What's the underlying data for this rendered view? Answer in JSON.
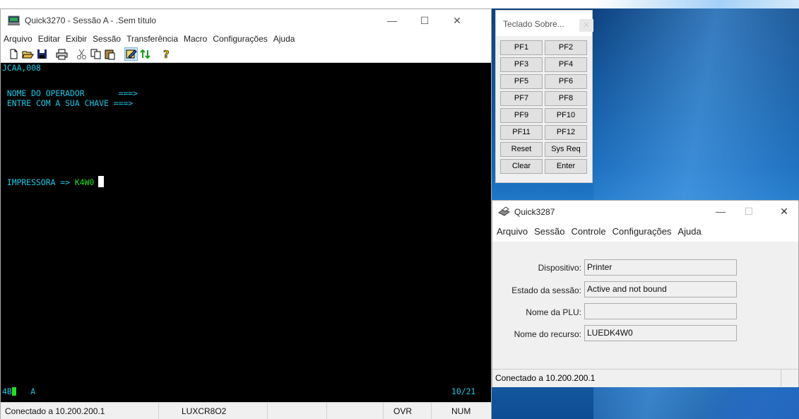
{
  "main_window": {
    "title": "Quick3270 - Sessão A - .Sem título",
    "minimize": "—",
    "maximize": "☐",
    "close": "✕",
    "menu": [
      "Arquivo",
      "Editar",
      "Exibir",
      "Sessão",
      "Transferência",
      "Macro",
      "Configurações",
      "Ajuda"
    ],
    "toolbar_icons": [
      "new-document-icon",
      "open-folder-icon",
      "save-icon",
      "print-icon",
      "cut-icon",
      "copy-icon",
      "paste-icon",
      "connect-icon",
      "transfer-icon",
      "help-icon"
    ]
  },
  "terminal": {
    "line1": "JCAA,008",
    "line2": " NOME DO OPERADOR       ===>",
    "line3": " ENTRE COM A SUA CHAVE ===>",
    "line4_label": " IMPRESSORA => ",
    "line4_value": "K4W0",
    "oia_left": "4B",
    "oia_mode": "A",
    "oia_pos": "10/21"
  },
  "status_bar": {
    "connection": "Conectado a 10.200.200.1",
    "lu_name": "LUXCR8O2",
    "ovr": "OVR",
    "num": "NUM"
  },
  "keypad": {
    "title": "Teclado Sobre...",
    "close": "✕",
    "keys": [
      [
        "PF1",
        "PF2"
      ],
      [
        "PF3",
        "PF4"
      ],
      [
        "PF5",
        "PF6"
      ],
      [
        "PF7",
        "PF8"
      ],
      [
        "PF9",
        "PF10"
      ],
      [
        "PF11",
        "PF12"
      ],
      [
        "Reset",
        "Sys Req"
      ],
      [
        "Clear",
        "Enter"
      ]
    ]
  },
  "printer_window": {
    "title": "Quick3287",
    "minimize": "—",
    "maximize": "☐",
    "close": "✕",
    "menu": [
      "Arquivo",
      "Sessão",
      "Controle",
      "Configurações",
      "Ajuda"
    ],
    "fields": [
      {
        "label": "Dispositivo:",
        "value": "Printer"
      },
      {
        "label": "Estado da sessão:",
        "value": "Active and not bound"
      },
      {
        "label": "Nome da PLU:",
        "value": ""
      },
      {
        "label": "Nome do recurso:",
        "value": "LUEDK4W0"
      }
    ],
    "status": "Conectado a 10.200.200.1"
  },
  "colors": {
    "terminal_bg": "#000000",
    "terminal_text": "#18c8e6",
    "terminal_input": "#23e023",
    "desktop": "#1568b8"
  }
}
